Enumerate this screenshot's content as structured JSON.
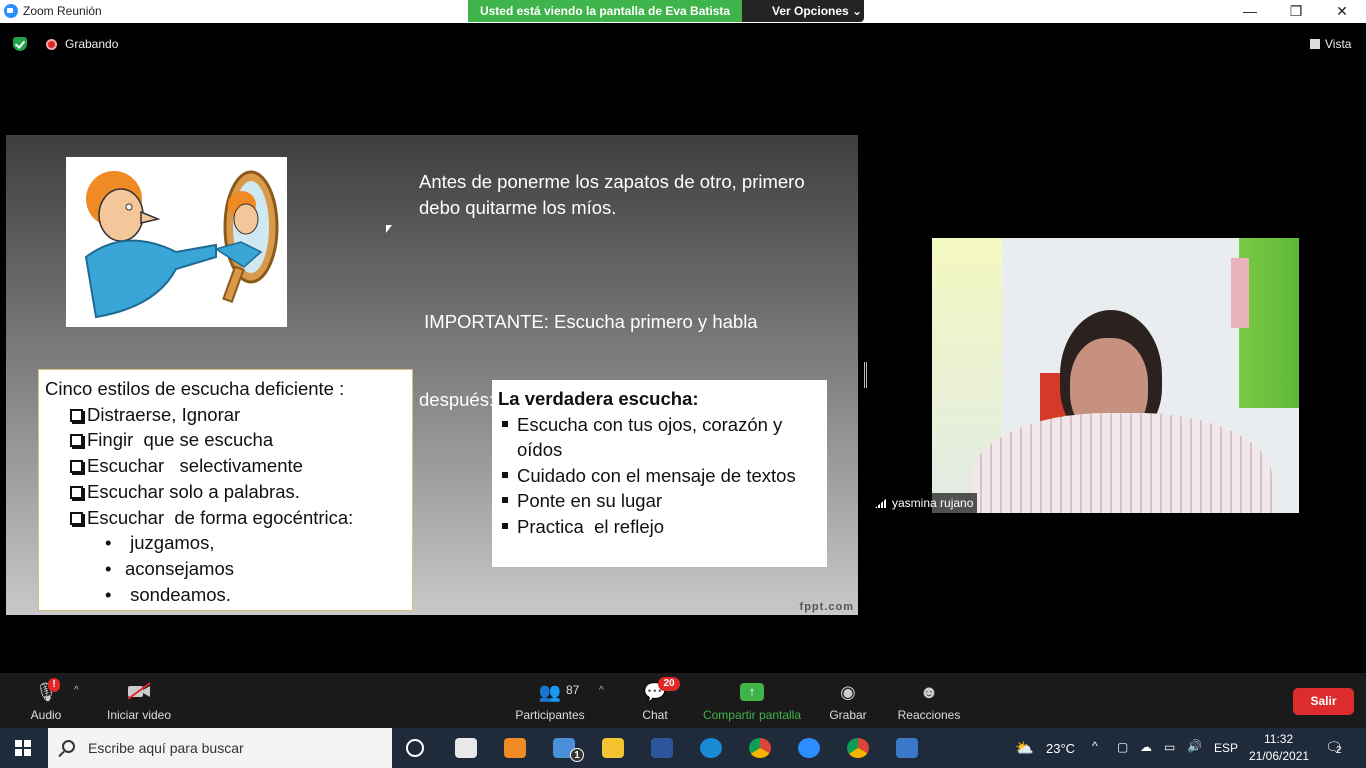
{
  "window": {
    "title": "Zoom Reunión",
    "share_banner": "Usted está viendo la pantalla de Eva Batista",
    "view_options": "Ver Opciones",
    "minimize": "—",
    "restore": "❐",
    "close": "✕"
  },
  "topbar": {
    "recording_label": "Grabando",
    "view_label": "Vista"
  },
  "slide": {
    "quote_line1": "Antes de ponerme los zapatos de otro, primero",
    "quote_line2": "debo quitarme los míos.",
    "important_line1": " IMPORTANTE: Escucha primero y habla",
    "important_line2": "después:",
    "left_box": {
      "heading": "Cinco estilos de escucha deficiente :",
      "items": [
        "Distraerse, Ignorar",
        "Fingir  que se escucha",
        "Escuchar   selectivamente",
        "Escuchar solo a palabras.",
        "Escuchar  de forma egocéntrica:"
      ],
      "subitems": [
        " juzgamos,",
        "aconsejamos",
        " sondeamos."
      ],
      "bullet": "•"
    },
    "right_box": {
      "heading": "La verdadera escucha:",
      "items": [
        "Escucha con tus ojos, corazón y",
        "oídos",
        "Cuidado con el mensaje de textos",
        "Ponte en su lugar",
        "Practica  el reflejo"
      ]
    },
    "watermark": "fppt.com"
  },
  "participant": {
    "name": "yasmina rujano"
  },
  "toolbar": {
    "audio_label": "Audio",
    "audio_alert": "!",
    "video_label": "Iniciar video",
    "participants_label": "Participantes",
    "participants_count": "87",
    "chat_label": "Chat",
    "chat_badge": "20",
    "share_label": "Compartir pantalla",
    "record_label": "Grabar",
    "reactions_label": "Reacciones",
    "leave_label": "Salir",
    "caret": "^"
  },
  "taskbar": {
    "search_placeholder": "Escribe aquí para buscar",
    "mail_badge": "1",
    "temperature": "23°C",
    "language": "ESP",
    "time": "11:32",
    "date": "21/06/2021",
    "notifications": "2"
  },
  "colors": {
    "share_green": "#3eb44a",
    "leave_red": "#dd2c2c",
    "toolbar_bg": "#1a1a1a",
    "taskbar_bg": "#1f2a3a"
  }
}
